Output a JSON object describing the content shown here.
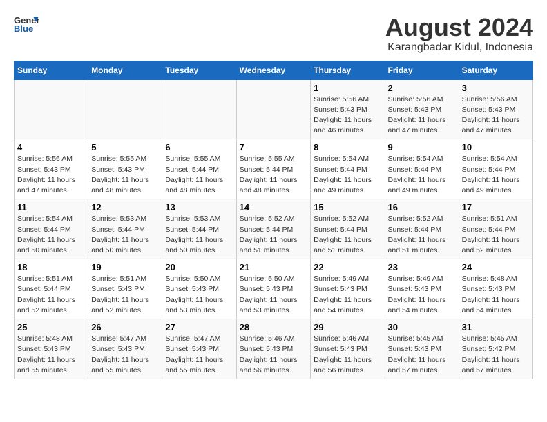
{
  "header": {
    "logo_line1": "General",
    "logo_line2": "Blue",
    "title": "August 2024",
    "subtitle": "Karangbadar Kidul, Indonesia"
  },
  "weekdays": [
    "Sunday",
    "Monday",
    "Tuesday",
    "Wednesday",
    "Thursday",
    "Friday",
    "Saturday"
  ],
  "weeks": [
    [
      {
        "day": "",
        "info": ""
      },
      {
        "day": "",
        "info": ""
      },
      {
        "day": "",
        "info": ""
      },
      {
        "day": "",
        "info": ""
      },
      {
        "day": "1",
        "info": "Sunrise: 5:56 AM\nSunset: 5:43 PM\nDaylight: 11 hours\nand 46 minutes."
      },
      {
        "day": "2",
        "info": "Sunrise: 5:56 AM\nSunset: 5:43 PM\nDaylight: 11 hours\nand 47 minutes."
      },
      {
        "day": "3",
        "info": "Sunrise: 5:56 AM\nSunset: 5:43 PM\nDaylight: 11 hours\nand 47 minutes."
      }
    ],
    [
      {
        "day": "4",
        "info": "Sunrise: 5:56 AM\nSunset: 5:43 PM\nDaylight: 11 hours\nand 47 minutes."
      },
      {
        "day": "5",
        "info": "Sunrise: 5:55 AM\nSunset: 5:43 PM\nDaylight: 11 hours\nand 48 minutes."
      },
      {
        "day": "6",
        "info": "Sunrise: 5:55 AM\nSunset: 5:44 PM\nDaylight: 11 hours\nand 48 minutes."
      },
      {
        "day": "7",
        "info": "Sunrise: 5:55 AM\nSunset: 5:44 PM\nDaylight: 11 hours\nand 48 minutes."
      },
      {
        "day": "8",
        "info": "Sunrise: 5:54 AM\nSunset: 5:44 PM\nDaylight: 11 hours\nand 49 minutes."
      },
      {
        "day": "9",
        "info": "Sunrise: 5:54 AM\nSunset: 5:44 PM\nDaylight: 11 hours\nand 49 minutes."
      },
      {
        "day": "10",
        "info": "Sunrise: 5:54 AM\nSunset: 5:44 PM\nDaylight: 11 hours\nand 49 minutes."
      }
    ],
    [
      {
        "day": "11",
        "info": "Sunrise: 5:54 AM\nSunset: 5:44 PM\nDaylight: 11 hours\nand 50 minutes."
      },
      {
        "day": "12",
        "info": "Sunrise: 5:53 AM\nSunset: 5:44 PM\nDaylight: 11 hours\nand 50 minutes."
      },
      {
        "day": "13",
        "info": "Sunrise: 5:53 AM\nSunset: 5:44 PM\nDaylight: 11 hours\nand 50 minutes."
      },
      {
        "day": "14",
        "info": "Sunrise: 5:52 AM\nSunset: 5:44 PM\nDaylight: 11 hours\nand 51 minutes."
      },
      {
        "day": "15",
        "info": "Sunrise: 5:52 AM\nSunset: 5:44 PM\nDaylight: 11 hours\nand 51 minutes."
      },
      {
        "day": "16",
        "info": "Sunrise: 5:52 AM\nSunset: 5:44 PM\nDaylight: 11 hours\nand 51 minutes."
      },
      {
        "day": "17",
        "info": "Sunrise: 5:51 AM\nSunset: 5:44 PM\nDaylight: 11 hours\nand 52 minutes."
      }
    ],
    [
      {
        "day": "18",
        "info": "Sunrise: 5:51 AM\nSunset: 5:44 PM\nDaylight: 11 hours\nand 52 minutes."
      },
      {
        "day": "19",
        "info": "Sunrise: 5:51 AM\nSunset: 5:43 PM\nDaylight: 11 hours\nand 52 minutes."
      },
      {
        "day": "20",
        "info": "Sunrise: 5:50 AM\nSunset: 5:43 PM\nDaylight: 11 hours\nand 53 minutes."
      },
      {
        "day": "21",
        "info": "Sunrise: 5:50 AM\nSunset: 5:43 PM\nDaylight: 11 hours\nand 53 minutes."
      },
      {
        "day": "22",
        "info": "Sunrise: 5:49 AM\nSunset: 5:43 PM\nDaylight: 11 hours\nand 54 minutes."
      },
      {
        "day": "23",
        "info": "Sunrise: 5:49 AM\nSunset: 5:43 PM\nDaylight: 11 hours\nand 54 minutes."
      },
      {
        "day": "24",
        "info": "Sunrise: 5:48 AM\nSunset: 5:43 PM\nDaylight: 11 hours\nand 54 minutes."
      }
    ],
    [
      {
        "day": "25",
        "info": "Sunrise: 5:48 AM\nSunset: 5:43 PM\nDaylight: 11 hours\nand 55 minutes."
      },
      {
        "day": "26",
        "info": "Sunrise: 5:47 AM\nSunset: 5:43 PM\nDaylight: 11 hours\nand 55 minutes."
      },
      {
        "day": "27",
        "info": "Sunrise: 5:47 AM\nSunset: 5:43 PM\nDaylight: 11 hours\nand 55 minutes."
      },
      {
        "day": "28",
        "info": "Sunrise: 5:46 AM\nSunset: 5:43 PM\nDaylight: 11 hours\nand 56 minutes."
      },
      {
        "day": "29",
        "info": "Sunrise: 5:46 AM\nSunset: 5:43 PM\nDaylight: 11 hours\nand 56 minutes."
      },
      {
        "day": "30",
        "info": "Sunrise: 5:45 AM\nSunset: 5:43 PM\nDaylight: 11 hours\nand 57 minutes."
      },
      {
        "day": "31",
        "info": "Sunrise: 5:45 AM\nSunset: 5:42 PM\nDaylight: 11 hours\nand 57 minutes."
      }
    ]
  ]
}
